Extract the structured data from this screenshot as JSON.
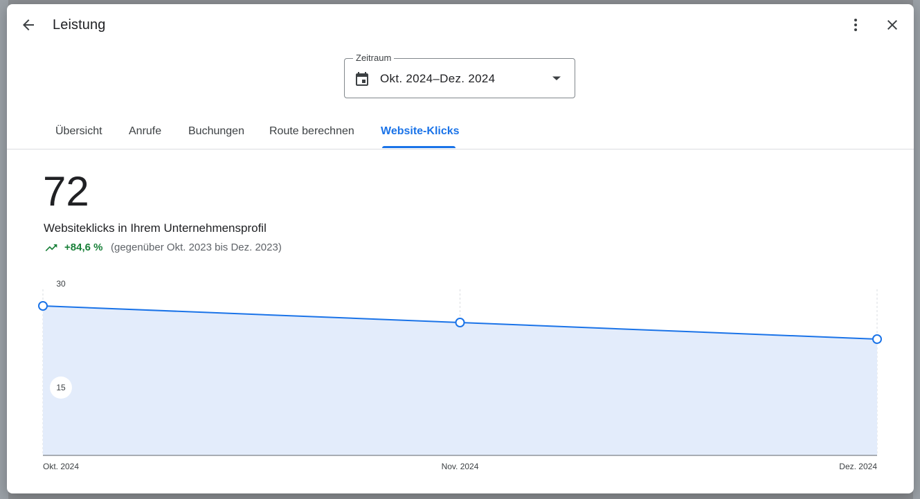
{
  "header": {
    "title": "Leistung",
    "back_icon": "arrow-back-icon",
    "more_icon": "more-vert-icon",
    "close_icon": "close-icon"
  },
  "date_range": {
    "label": "Zeitraum",
    "value": "Okt. 2024–Dez. 2024",
    "icon": "calendar-icon"
  },
  "tabs": [
    {
      "label": "Übersicht",
      "active": false
    },
    {
      "label": "Anrufe",
      "active": false
    },
    {
      "label": "Buchungen",
      "active": false
    },
    {
      "label": "Route berechnen",
      "active": false
    },
    {
      "label": "Website-Klicks",
      "active": true
    }
  ],
  "summary": {
    "value": "72",
    "description": "Websiteklicks in Ihrem Unternehmensprofil",
    "trend_value": "+84,6 %",
    "trend_compare": "(gegenüber Okt. 2023 bis Dez. 2023)",
    "trend_icon": "trending-up-icon"
  },
  "colors": {
    "accent": "#1a73e8",
    "positive": "#188038",
    "area_fill": "#e3ecfb"
  },
  "chart_data": {
    "type": "area",
    "categories": [
      "Okt. 2024",
      "Nov. 2024",
      "Dez. 2024"
    ],
    "values": [
      27,
      24,
      21
    ],
    "ylim": [
      0,
      30
    ],
    "yticks": [
      15,
      30
    ],
    "ytick_labels": [
      "15",
      "30"
    ],
    "grid": "vertical-dashed",
    "legend": "none"
  }
}
